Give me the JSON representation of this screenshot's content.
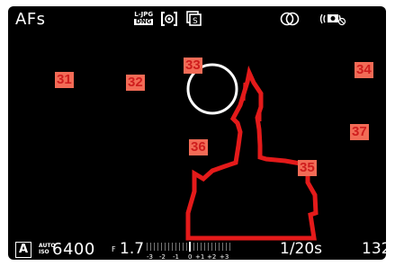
{
  "status_bar": {
    "focus_mode": "AFs",
    "file_format_top": "L-JPG",
    "file_format_bottom": "DNG",
    "metering_icon": "spot-metering-icon",
    "drive_icon": "drive-mode-icon",
    "overlap_icon": "multi-exposure-icon",
    "stabilization_icon": "image-stabilization-icon"
  },
  "callouts": [
    "31",
    "32",
    "33",
    "34",
    "35",
    "36",
    "37"
  ],
  "bottom_bar": {
    "exposure_mode": "A",
    "iso_top": "AUTO",
    "iso_bottom": "ISO",
    "iso_value": "6400",
    "aperture_prefix": "F",
    "aperture_value": "1.7",
    "ev_labels": [
      "-3",
      "-2",
      "-1",
      "0",
      "+1",
      "+2",
      "+3"
    ],
    "shutter_speed": "1/20s",
    "shots_remaining": "132"
  },
  "colors": {
    "screen_bg": "#000000",
    "focus_outline": "#e41a1a",
    "callout_bg": "#f26b56",
    "callout_text": "#cf1d1d"
  }
}
